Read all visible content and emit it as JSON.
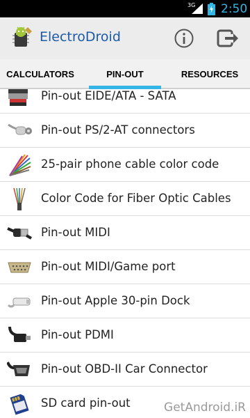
{
  "status_bar": {
    "network": "3G",
    "time": "2:50"
  },
  "app_bar": {
    "title": "ElectroDroid",
    "info_icon": "info-icon",
    "exit_icon": "exit-icon"
  },
  "tabs": [
    {
      "label": "CALCULATORS",
      "selected": false
    },
    {
      "label": "PIN-OUT",
      "selected": true
    },
    {
      "label": "RESOURCES",
      "selected": false
    }
  ],
  "pinout_list": [
    {
      "label": "Pin-out EIDE/ATA - SATA",
      "icon": "ide-cable-icon"
    },
    {
      "label": "Pin-out PS/2-AT connectors",
      "icon": "ps2-connector-icon"
    },
    {
      "label": "25-pair phone cable color code",
      "icon": "phone-cable-icon"
    },
    {
      "label": "Color Code for Fiber Optic Cables",
      "icon": "fiber-optic-icon"
    },
    {
      "label": "Pin-out MIDI",
      "icon": "midi-connector-icon"
    },
    {
      "label": "Pin-out MIDI/Game port",
      "icon": "game-port-icon"
    },
    {
      "label": "Pin-out Apple 30-pin Dock",
      "icon": "apple-dock-icon"
    },
    {
      "label": "Pin-out PDMI",
      "icon": "pdmi-connector-icon"
    },
    {
      "label": "Pin-out OBD-II Car Connector",
      "icon": "obd-connector-icon"
    },
    {
      "label": "SD card pin-out",
      "icon": "sd-card-icon"
    }
  ],
  "watermark": "GetAndroid.iR",
  "colors": {
    "accent": "#33b5e5",
    "title": "#1a5aa8",
    "action_bar": "#ececec"
  }
}
